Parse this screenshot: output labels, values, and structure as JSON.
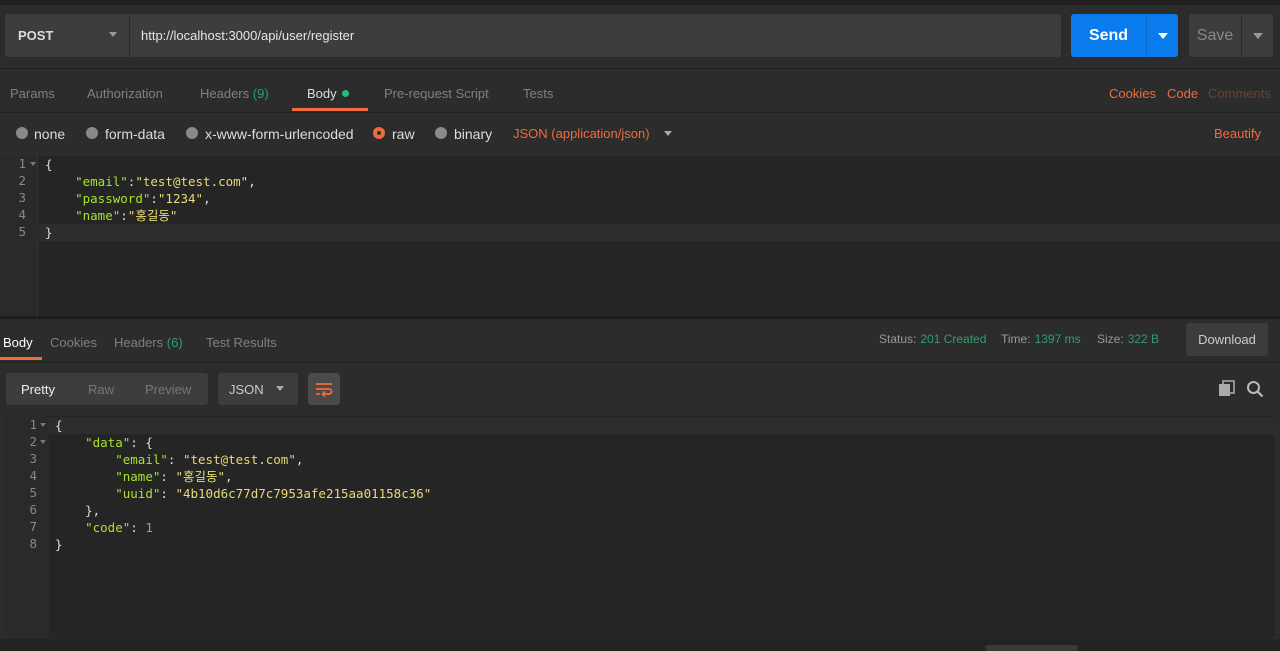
{
  "request": {
    "method": "POST",
    "url": "http://localhost:3000/api/user/register",
    "send_label": "Send",
    "save_label": "Save",
    "tabs": [
      {
        "label": "Params"
      },
      {
        "label": "Authorization"
      },
      {
        "label": "Headers",
        "count": "(9)"
      },
      {
        "label": "Body"
      },
      {
        "label": "Pre-request Script"
      },
      {
        "label": "Tests"
      }
    ],
    "links": {
      "cookies": "Cookies",
      "code": "Code",
      "comments": "Comments"
    },
    "body_types": [
      "none",
      "form-data",
      "x-www-form-urlencoded",
      "raw",
      "binary"
    ],
    "selected_body_type": "raw",
    "content_type": "JSON (application/json)",
    "beautify": "Beautify",
    "line_numbers": [
      "1",
      "2",
      "3",
      "4",
      "5"
    ],
    "code": {
      "open": "{",
      "k1": "\"email\"",
      "v1": "\"test@test.com\"",
      "k2": "\"password\"",
      "v2": "\"1234\"",
      "k3": "\"name\"",
      "v3": "\"홍길동\"",
      "close": "}"
    }
  },
  "response": {
    "tabs": [
      {
        "label": "Body"
      },
      {
        "label": "Cookies"
      },
      {
        "label": "Headers",
        "count": "(6)"
      },
      {
        "label": "Test Results"
      }
    ],
    "status_label": "Status:",
    "status_value": "201 Created",
    "time_label": "Time:",
    "time_value": "1397 ms",
    "size_label": "Size:",
    "size_value": "322 B",
    "download": "Download",
    "view_modes": [
      "Pretty",
      "Raw",
      "Preview"
    ],
    "format": "JSON",
    "line_numbers": [
      "1",
      "2",
      "3",
      "4",
      "5",
      "6",
      "7",
      "8"
    ],
    "code": {
      "open": "{",
      "data_key": "\"data\"",
      "email_key": "\"email\"",
      "email_val": "\"test@test.com\"",
      "name_key": "\"name\"",
      "name_val": "\"홍길동\"",
      "uuid_key": "\"uuid\"",
      "uuid_val": "\"4b10d6c77d7c7953afe215aa01158c36\"",
      "inner_close": "},",
      "code_key": "\"code\"",
      "code_val": "1",
      "close": "}"
    }
  },
  "colors": {
    "accent": "#f26b3a",
    "send": "#097bed",
    "status_ok": "#2aa06b"
  }
}
